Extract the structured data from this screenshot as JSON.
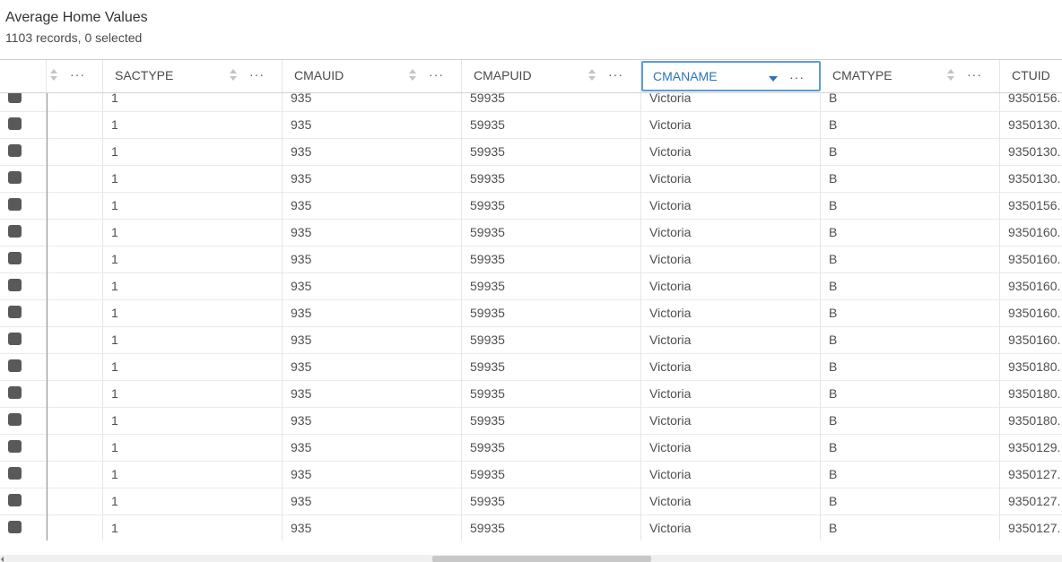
{
  "header": {
    "title": "Average Home Values",
    "subtitle": "1103 records, 0 selected"
  },
  "columns": [
    {
      "label": ""
    },
    {
      "label": "SACTYPE"
    },
    {
      "label": "CMAUID"
    },
    {
      "label": "CMAPUID"
    },
    {
      "label": "CMANAME",
      "sort": "descending"
    },
    {
      "label": "CMATYPE"
    },
    {
      "label": "CTUID"
    }
  ],
  "more_glyph": "···",
  "rows": [
    [
      "1",
      "935",
      "59935",
      "Victoria",
      "B",
      "9350156."
    ],
    [
      "1",
      "935",
      "59935",
      "Victoria",
      "B",
      "9350130."
    ],
    [
      "1",
      "935",
      "59935",
      "Victoria",
      "B",
      "9350130."
    ],
    [
      "1",
      "935",
      "59935",
      "Victoria",
      "B",
      "9350130."
    ],
    [
      "1",
      "935",
      "59935",
      "Victoria",
      "B",
      "9350156."
    ],
    [
      "1",
      "935",
      "59935",
      "Victoria",
      "B",
      "9350160."
    ],
    [
      "1",
      "935",
      "59935",
      "Victoria",
      "B",
      "9350160."
    ],
    [
      "1",
      "935",
      "59935",
      "Victoria",
      "B",
      "9350160."
    ],
    [
      "1",
      "935",
      "59935",
      "Victoria",
      "B",
      "9350160."
    ],
    [
      "1",
      "935",
      "59935",
      "Victoria",
      "B",
      "9350160."
    ],
    [
      "1",
      "935",
      "59935",
      "Victoria",
      "B",
      "9350180."
    ],
    [
      "1",
      "935",
      "59935",
      "Victoria",
      "B",
      "9350180."
    ],
    [
      "1",
      "935",
      "59935",
      "Victoria",
      "B",
      "9350180."
    ],
    [
      "1",
      "935",
      "59935",
      "Victoria",
      "B",
      "9350129."
    ],
    [
      "1",
      "935",
      "59935",
      "Victoria",
      "B",
      "9350127."
    ],
    [
      "1",
      "935",
      "59935",
      "Victoria",
      "B",
      "9350127."
    ],
    [
      "1",
      "935",
      "59935",
      "Victoria",
      "B",
      "9350127."
    ]
  ],
  "colors": {
    "accent": "#2a74b8",
    "checkbox": "#595959"
  }
}
